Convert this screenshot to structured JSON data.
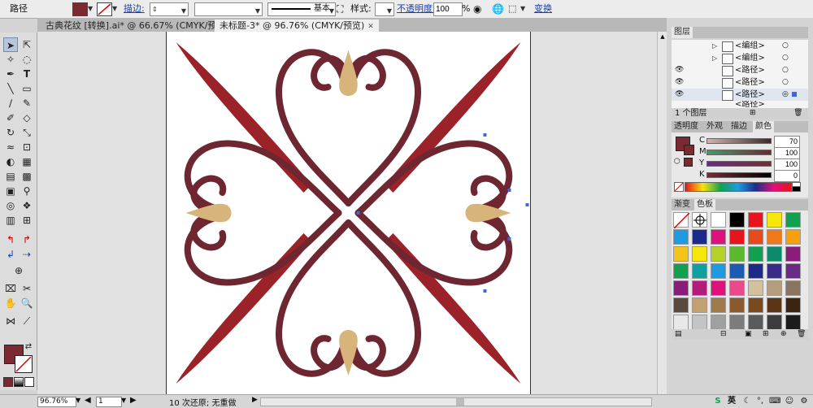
{
  "control_bar": {
    "object_type": "路径",
    "stroke_label": "描边:",
    "stroke_profile": "基本",
    "style_label": "样式:",
    "opacity_label": "不透明度:",
    "opacity_value": "100",
    "opacity_unit": "%",
    "transform_label": "变换",
    "fill_color": "#7a2a30"
  },
  "tabs": [
    {
      "label": "古典花纹 [转换].ai* @ 66.67% (CMYK/预览)",
      "active": false
    },
    {
      "label": "未标题-3* @ 96.76% (CMYK/预览)",
      "active": true
    }
  ],
  "layers_panel": {
    "title": "图层",
    "rows": [
      {
        "label": "<编组>"
      },
      {
        "label": "<编组>"
      },
      {
        "label": "<路径>"
      },
      {
        "label": "<路径>"
      },
      {
        "label": "<路径>"
      },
      {
        "label": "<路径>"
      }
    ],
    "footer": "1 个图层"
  },
  "color_panel": {
    "tabs": [
      "透明度",
      "外观",
      "描边",
      "颜色"
    ],
    "active_tab": "颜色",
    "channels": [
      {
        "name": "C",
        "value": "70"
      },
      {
        "name": "M",
        "value": "100"
      },
      {
        "name": "Y",
        "value": "100"
      },
      {
        "name": "K",
        "value": "0"
      }
    ]
  },
  "swatches_panel": {
    "tabs": [
      "渐变",
      "色板"
    ],
    "active_tab": "色板",
    "colors": [
      "#ffffff",
      "#ffffff",
      "#ffffff",
      "#000000",
      "#e8141c",
      "#f5e60c",
      "#10a050",
      "#1e9be0",
      "#1c2a8a",
      "#e0107c",
      "#e8141c",
      "#e84a1c",
      "#f07818",
      "#f5a00c",
      "#f5c418",
      "#f5e60c",
      "#b4d228",
      "#5cb82c",
      "#10a050",
      "#0c8a6a",
      "#8a1c7c",
      "#10a050",
      "#10a0a0",
      "#1e9be0",
      "#1c5ab4",
      "#1c2a8a",
      "#3a2a8a",
      "#6a2a8a",
      "#8a1c7c",
      "#b41c7c",
      "#e0107c",
      "#e84a8a",
      "#d4c09c",
      "#b49c7c",
      "#8a7460",
      "#5a4a3c",
      "#c4a070",
      "#a07a4a",
      "#8a5a2c",
      "#7a4a1c",
      "#5a3414",
      "#3c2410",
      "#e8e8e8",
      "#c4c4c4",
      "#a0a0a0",
      "#7c7c7c",
      "#5a5a5a",
      "#3c3c3c",
      "#1c1c1c"
    ]
  },
  "status_bar": {
    "zoom": "96.76%",
    "page": "1",
    "history": "10 次还原; 无重做"
  },
  "taskbar": {
    "ime": "英"
  },
  "art_colors": {
    "heart": "#6e2630",
    "blade": "#9b2228",
    "petal": "#d6b47a"
  }
}
